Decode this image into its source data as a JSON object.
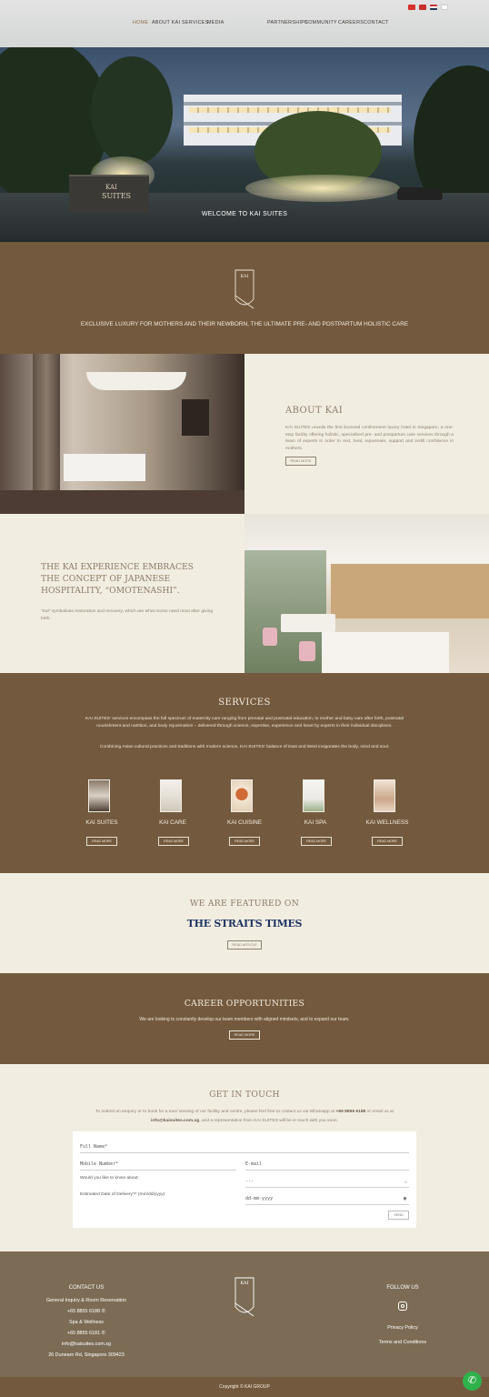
{
  "nav": {
    "left": [
      "HOME",
      "ABOUT KAI",
      "SERVICES",
      "MEDIA"
    ],
    "right": [
      "PARTNERSHIPS",
      "COMMUNITY",
      "CAREERS",
      "CONTACT"
    ],
    "languages": [
      "zh-CN",
      "zh-TW",
      "en",
      "ko"
    ]
  },
  "hero": {
    "welcome": "WELCOME TO KAI SUITES",
    "sign_top": "KAI",
    "sign_bottom": "SUITES"
  },
  "intro": {
    "logo_text": "KAI",
    "tagline": "EXCLUSIVE LUXURY FOR MOTHERS AND THEIR NEWBORN, THE ULTIMATE PRE- AND POSTPARTUM HOLISTIC CARE"
  },
  "about": {
    "title": "ABOUT KAI",
    "body": "KAI SUITES unveils the first licensed confinement luxury hotel in Singapore, a one-stop facility offering holistic, specialised pre- and postpartum care services through a team of experts in order to rest, heal, rejuvenate, support and instill confidence in mothers.",
    "button": "READ MORE"
  },
  "experience": {
    "title": "THE KAI EXPERIENCE EMBRACES THE CONCEPT OF JAPANESE HOSPITALITY, “OMOTENASHI”.",
    "body": "“Kai” symbolises restoration and recovery, which are what moms need most after giving birth."
  },
  "services": {
    "title": "SERVICES",
    "p1": "KAI SUITES' services encompass the full spectrum of maternity care ranging from prenatal and postnatal education, to mother and baby care after birth, postnatal nourishment and nutrition, and body rejuvenation – delivered through science, expertise, experience and heart by experts in their individual disciplines.",
    "p2": "Combining Asian cultural practices and traditions with modern science, KAI SUITES' balance of East and West invigorates the body, mind and soul.",
    "items": [
      {
        "label": "KAI SUITES",
        "button": "READ MORE"
      },
      {
        "label": "KAI CARE",
        "button": "READ MORE"
      },
      {
        "label": "KAI CUISINE",
        "button": "READ MORE"
      },
      {
        "label": "KAI SPA",
        "button": "READ MORE"
      },
      {
        "label": "KAI WELLNESS",
        "button": "READ MORE"
      }
    ]
  },
  "featured": {
    "title": "WE ARE FEATURED ON",
    "publication": "THE STRAITS TIMES",
    "button": "READ ARTICLE"
  },
  "career": {
    "title": "CAREER OPPORTUNITIES",
    "body": "We are looking to constantly develop our team members with aligned mindsets, and to expand our team.",
    "button": "READ MORE"
  },
  "contact": {
    "title": "GET IN TOUCH",
    "intro_a": "To submit an enquiry or to book for a tour/ viewing of our facility and centre, please feel free to contact us via Whatsapp at ",
    "phone": "+65 8855 6188",
    "intro_b": " or email us at",
    "email": "info@kaisuites.com.sg",
    "intro_c": ", and a representative from KAI SUITES will be in touch with you soon.",
    "form": {
      "full_name": "Full Name*",
      "mobile": "Mobile Number*",
      "email": "E-mail",
      "know_about": "Would you like to know about:",
      "select_value": "---",
      "delivery": "Estimated Date of Delivery?* (mm/dd/yyyy)",
      "date_placeholder": "dd-mm-yyyy",
      "send": "SEND"
    }
  },
  "footer": {
    "contact_title": "CONTACT US",
    "general": "General Inquiry & Room Reservation",
    "general_phone": "+65 8855 6188",
    "spa": "Spa & Wellness",
    "spa_phone": "+65 8855 6181",
    "email": "info@kaisuites.com.sg",
    "address": "26 Dunearn Rd, Singapore 309423",
    "logo_text": "KAI",
    "follow_title": "FOLLOW US",
    "privacy": "Privacy Policy",
    "terms": "Terms and Conditions",
    "copyright": "Copyright © KAI GROUP"
  },
  "colors": {
    "brown": "#735a3e",
    "cream": "#f2ede1",
    "whatsapp": "#2fb24c",
    "straits_blue": "#1d3564"
  }
}
